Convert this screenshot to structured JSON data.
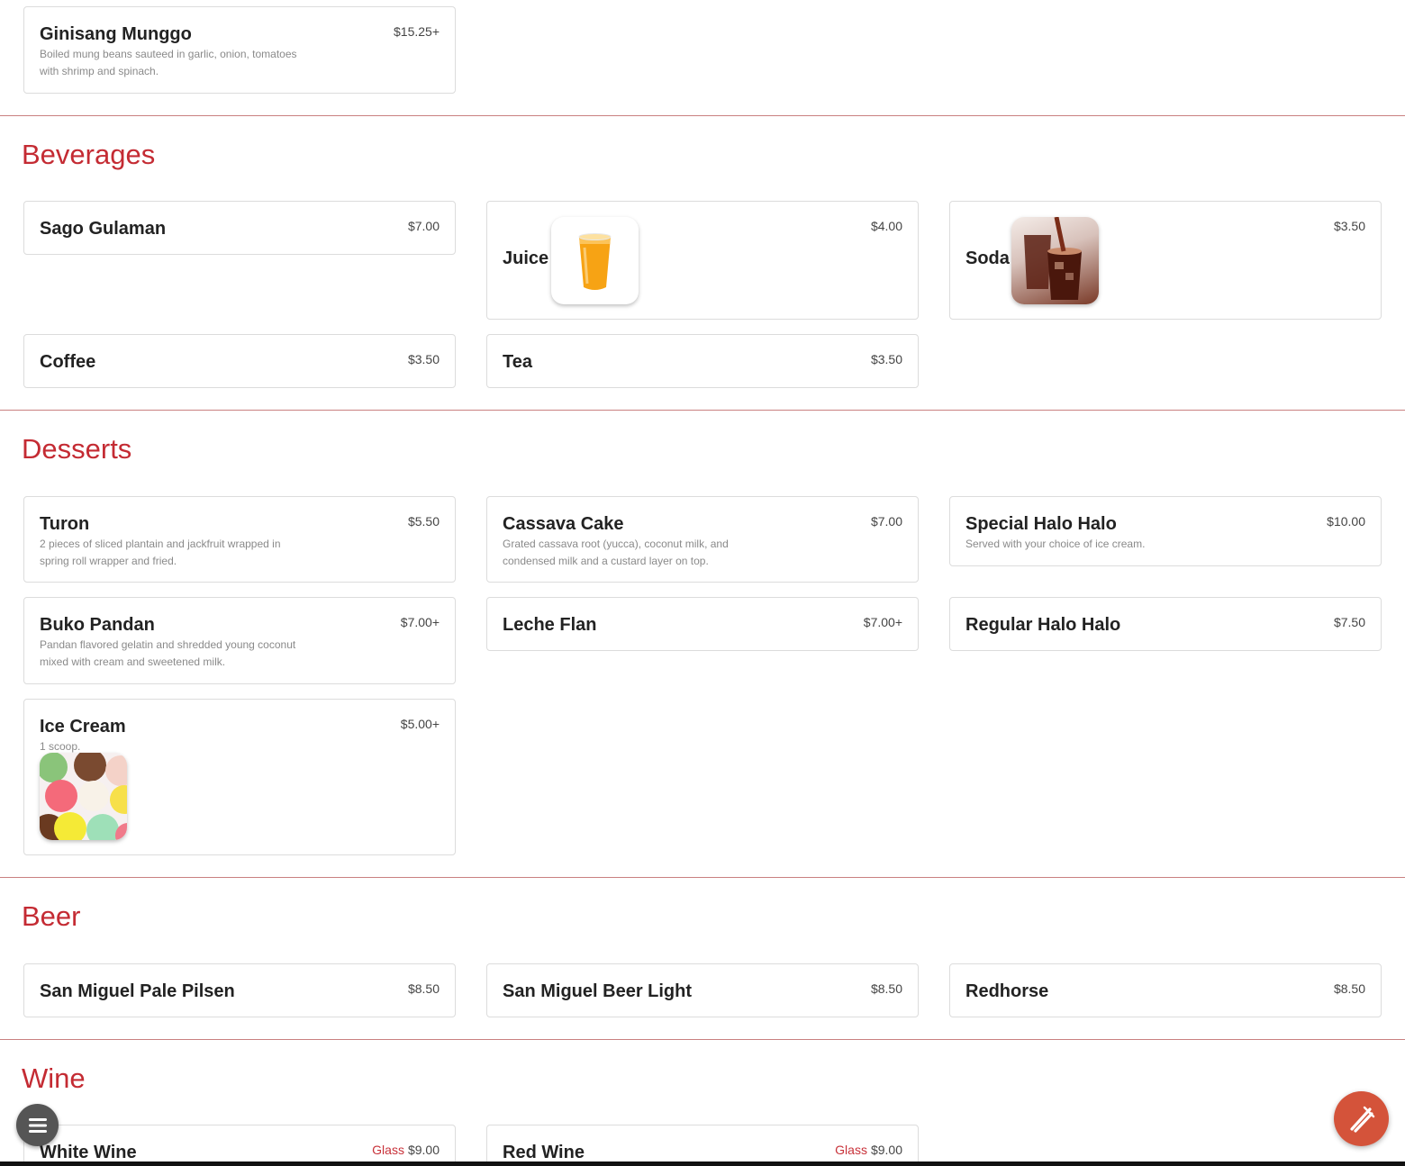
{
  "sections": {
    "prev": {
      "items": [
        {
          "name": "Ginisang Munggo",
          "price": "$15.25+",
          "desc": "Boiled mung beans sauteed in garlic, onion, tomatoes with shrimp and spinach."
        }
      ]
    },
    "beverages": {
      "title": "Beverages",
      "items": [
        {
          "name": "Sago Gulaman",
          "price": "$7.00"
        },
        {
          "name": "Juice",
          "price": "$4.00",
          "image": "orange-juice-glass"
        },
        {
          "name": "Soda",
          "price": "$3.50",
          "image": "soda-glasses"
        },
        {
          "name": "Coffee",
          "price": "$3.50"
        },
        {
          "name": "Tea",
          "price": "$3.50"
        }
      ]
    },
    "desserts": {
      "title": "Desserts",
      "items": [
        {
          "name": "Turon",
          "price": "$5.50",
          "desc": "2 pieces of sliced plantain and jackfruit wrapped in spring roll wrapper and fried."
        },
        {
          "name": "Cassava Cake",
          "price": "$7.00",
          "desc": "Grated cassava root (yucca), coconut milk, and condensed milk and a custard layer on top."
        },
        {
          "name": "Special Halo Halo",
          "price": "$10.00",
          "desc": "Served with your choice of ice cream."
        },
        {
          "name": "Buko Pandan",
          "price": "$7.00+",
          "desc": "Pandan flavored gelatin and shredded young coconut mixed with cream and sweetened milk."
        },
        {
          "name": "Leche Flan",
          "price": "$7.00+"
        },
        {
          "name": "Regular Halo Halo",
          "price": "$7.50"
        },
        {
          "name": "Ice Cream",
          "price": "$5.00+",
          "desc": "1 scoop.",
          "image": "ice-cream-scoops"
        }
      ]
    },
    "beer": {
      "title": "Beer",
      "items": [
        {
          "name": "San Miguel Pale Pilsen",
          "price": "$8.50"
        },
        {
          "name": "San Miguel Beer Light",
          "price": "$8.50"
        },
        {
          "name": "Redhorse",
          "price": "$8.50"
        }
      ]
    },
    "wine": {
      "title": "Wine",
      "items": [
        {
          "name": "White Wine",
          "option": "Glass",
          "price": "$9.00"
        },
        {
          "name": "Red Wine",
          "option": "Glass",
          "price": "$9.00"
        }
      ]
    }
  },
  "buttons": {
    "menu_icon": "hamburger-icon",
    "order_icon": "utensils-icon"
  },
  "colors": {
    "accent": "#c42b33",
    "separator": "#c98080",
    "order_fab": "#d4533a",
    "menu_fab": "#555555"
  }
}
